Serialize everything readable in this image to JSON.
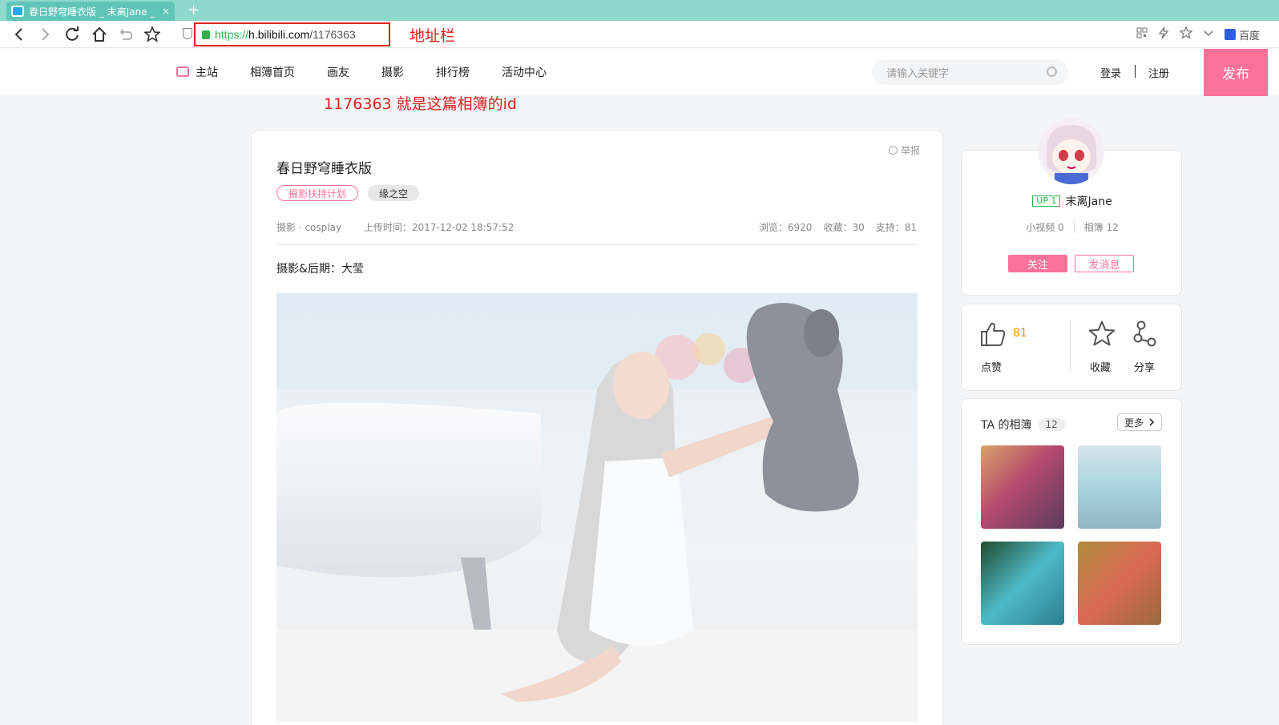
{
  "browser": {
    "tab_title": "春日野穹睡衣版 _ 末离Jane _",
    "tab_close": "×",
    "new_tab": "+",
    "url_proto": "https://",
    "url_host": "h.bilibili.com",
    "url_path": "/1176363",
    "search_engine": "百度"
  },
  "annotations": {
    "address_bar": "地址栏",
    "album_id_note": "1176363 就是这篇相簿的id"
  },
  "site": {
    "nav": [
      "主站",
      "相簿首页",
      "画友",
      "摄影",
      "排行榜",
      "活动中心"
    ],
    "search_placeholder": "请输入关键字",
    "login": "登录",
    "register": "注册",
    "publish": "发布",
    "accent_color": "#fb7299"
  },
  "album": {
    "report": "举报",
    "title": "春日野穹睡衣版",
    "tags": [
      "摄影扶持计划",
      "缘之空"
    ],
    "category": "摄影 · cosplay",
    "upload_time": "上传时间：2017-12-02 18:57:52",
    "views": "浏览：6920",
    "favorites": "收藏：30",
    "supports": "支持：81",
    "credit": "摄影&后期：大莹"
  },
  "uploader": {
    "level": "UP 1",
    "name": "末离Jane",
    "videos": "小视频 0",
    "albums": "相簿 12",
    "follow": "关注",
    "message": "发消息"
  },
  "actions": {
    "like_count": "81",
    "like": "点赞",
    "favorite": "收藏",
    "share": "分享"
  },
  "ta_albums": {
    "title": "TA 的相簿",
    "count": "12",
    "more": "更多"
  }
}
